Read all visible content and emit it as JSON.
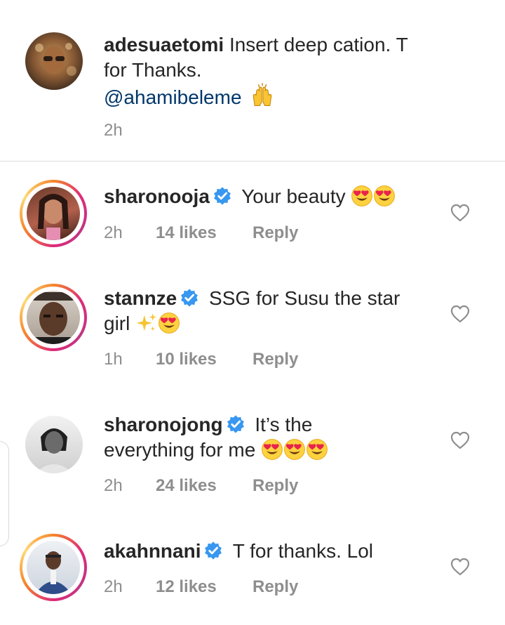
{
  "caption": {
    "username": "adesuaetomi",
    "text_line1": "Insert deep cation. T",
    "text_line2": "for Thanks.",
    "mention": "@ahamibeleme",
    "time": "2h"
  },
  "comments": [
    {
      "username": "sharonooja",
      "verified": true,
      "text": "Your beauty",
      "emoji": [
        "heart-eyes",
        "heart-eyes"
      ],
      "time": "2h",
      "likes": "14 likes",
      "reply": "Reply"
    },
    {
      "username": "stannze",
      "verified": true,
      "text_line1": "SSG for Susu the star",
      "text_line2": "girl",
      "emoji": [
        "sparkles",
        "heart-eyes"
      ],
      "time": "1h",
      "likes": "10 likes",
      "reply": "Reply"
    },
    {
      "username": "sharonojong",
      "verified": true,
      "text_line1": "It’s the",
      "text_line2": "everything for me",
      "emoji": [
        "heart-eyes",
        "heart-eyes",
        "heart-eyes"
      ],
      "time": "2h",
      "likes": "24 likes",
      "reply": "Reply"
    },
    {
      "username": "akahnnani",
      "verified": true,
      "text": "T for thanks. Lol",
      "time": "2h",
      "likes": "12 likes",
      "reply": "Reply"
    }
  ],
  "colors": {
    "verified": "#3897f0",
    "mention": "#00376b",
    "meta": "#8e8e8e",
    "text": "#262626"
  },
  "icons": [
    "verified-badge-icon",
    "heart-outline-icon",
    "raising-hands-emoji",
    "heart-eyes-emoji",
    "sparkles-emoji"
  ]
}
